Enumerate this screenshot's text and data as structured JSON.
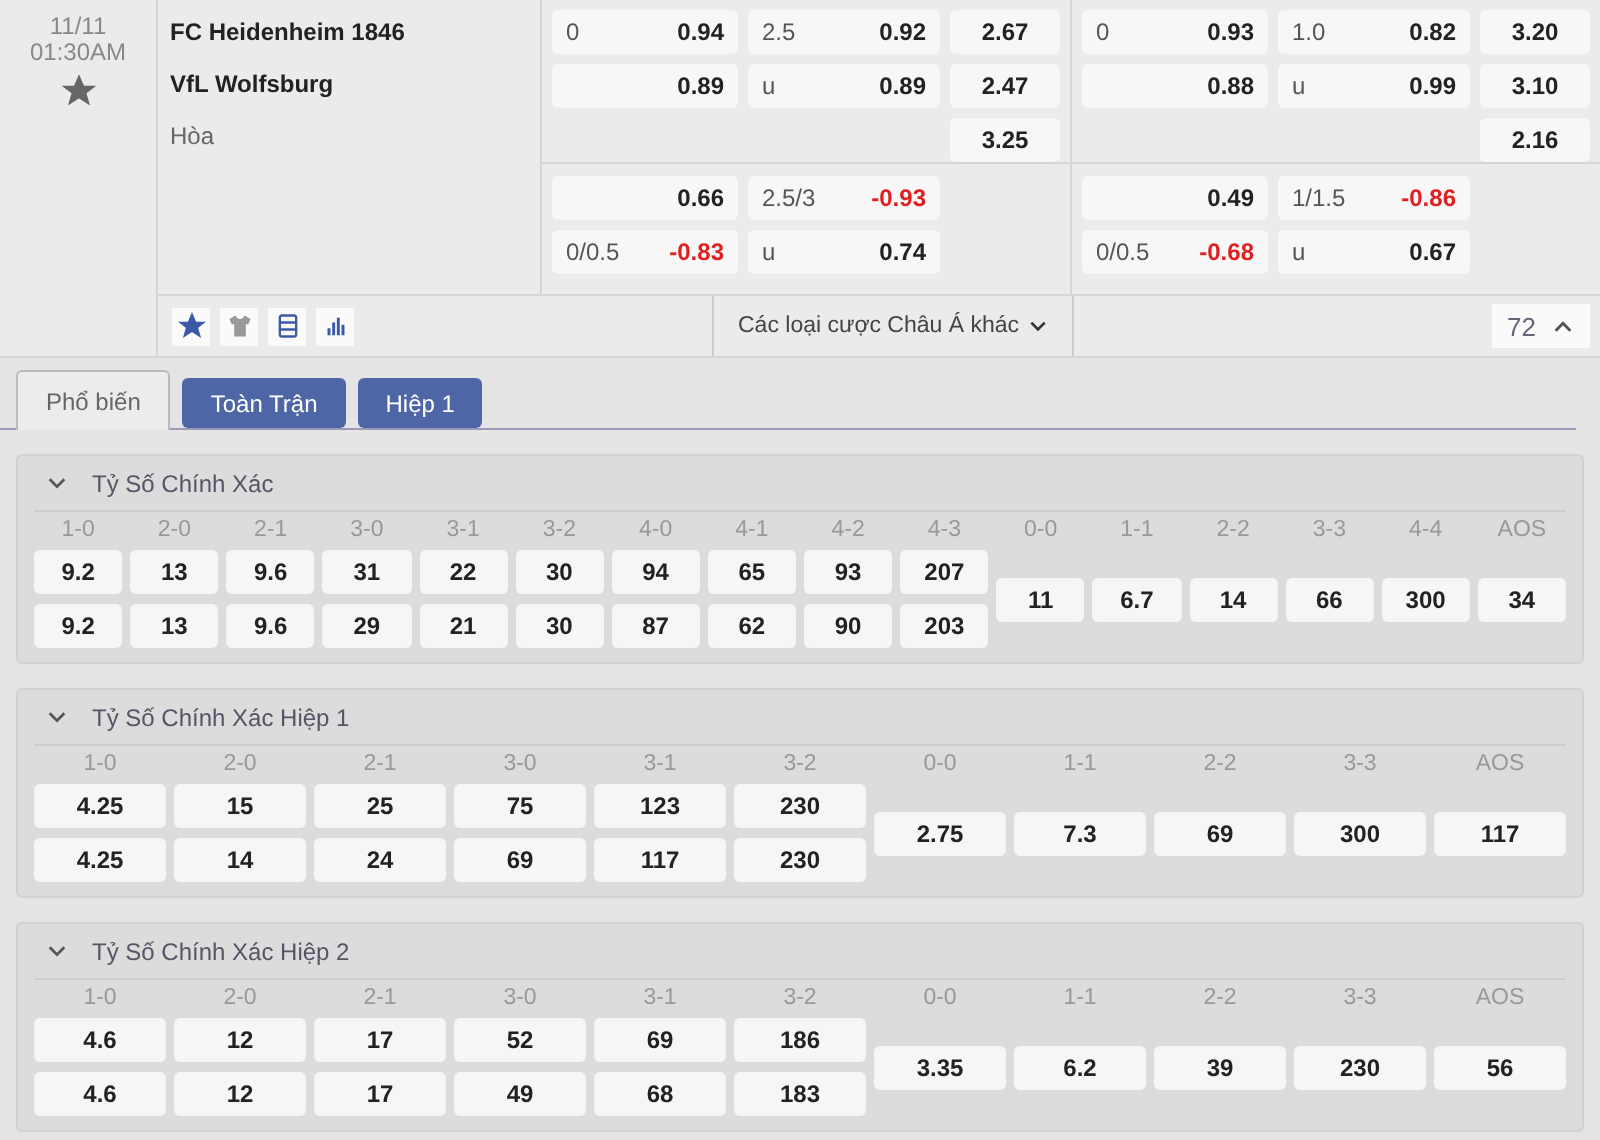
{
  "match": {
    "date": "11/11",
    "time": "01:30AM",
    "starred": true,
    "home": "FC Heidenheim 1846",
    "away": "VfL Wolfsburg",
    "draw": "Hòa"
  },
  "odds_groups": [
    {
      "main": [
        {
          "handicap": {
            "line": "0",
            "odds": "0.94",
            "negative": false
          },
          "total": {
            "line": "2.5",
            "odds": "0.92",
            "negative": false
          },
          "x12": "2.67"
        },
        {
          "handicap": {
            "odds": "0.89",
            "negative": false
          },
          "total": {
            "line": "u",
            "odds": "0.89",
            "negative": false
          },
          "x12": "2.47"
        },
        {
          "x12": "3.25"
        }
      ],
      "alt": [
        {
          "handicap": {
            "odds": "0.66",
            "negative": false
          },
          "total": {
            "line": "2.5/3",
            "odds": "-0.93",
            "negative": true
          }
        },
        {
          "handicap": {
            "line": "0/0.5",
            "odds": "-0.83",
            "negative": true
          },
          "total": {
            "line": "u",
            "odds": "0.74",
            "negative": false
          }
        }
      ]
    },
    {
      "main": [
        {
          "handicap": {
            "line": "0",
            "odds": "0.93",
            "negative": false
          },
          "total": {
            "line": "1.0",
            "odds": "0.82",
            "negative": false
          },
          "x12": "3.20"
        },
        {
          "handicap": {
            "odds": "0.88",
            "negative": false
          },
          "total": {
            "line": "u",
            "odds": "0.99",
            "negative": false
          },
          "x12": "3.10"
        },
        {
          "x12": "2.16"
        }
      ],
      "alt": [
        {
          "handicap": {
            "odds": "0.49",
            "negative": false
          },
          "total": {
            "line": "1/1.5",
            "odds": "-0.86",
            "negative": true
          }
        },
        {
          "handicap": {
            "line": "0/0.5",
            "odds": "-0.68",
            "negative": true
          },
          "total": {
            "line": "u",
            "odds": "0.67",
            "negative": false
          }
        }
      ]
    }
  ],
  "toolbar": {
    "favorite": true,
    "more_label": "Các loại cược Châu Á khác",
    "count": "72"
  },
  "tabs": [
    {
      "label": "Phổ biến",
      "selected": true
    },
    {
      "label": "Toàn Trận",
      "selected": false
    },
    {
      "label": "Hiệp 1",
      "selected": false
    }
  ],
  "sections": [
    {
      "title": "Tỷ Số Chính Xác",
      "expanded": true,
      "columns": [
        {
          "label": "1-0",
          "values": [
            "9.2",
            "9.2"
          ]
        },
        {
          "label": "2-0",
          "values": [
            "13",
            "13"
          ]
        },
        {
          "label": "2-1",
          "values": [
            "9.6",
            "9.6"
          ]
        },
        {
          "label": "3-0",
          "values": [
            "31",
            "29"
          ]
        },
        {
          "label": "3-1",
          "values": [
            "22",
            "21"
          ]
        },
        {
          "label": "3-2",
          "values": [
            "30",
            "30"
          ]
        },
        {
          "label": "4-0",
          "values": [
            "94",
            "87"
          ]
        },
        {
          "label": "4-1",
          "values": [
            "65",
            "62"
          ]
        },
        {
          "label": "4-2",
          "values": [
            "93",
            "90"
          ]
        },
        {
          "label": "4-3",
          "values": [
            "207",
            "203"
          ]
        },
        {
          "label": "0-0",
          "values": [
            "11"
          ]
        },
        {
          "label": "1-1",
          "values": [
            "6.7"
          ]
        },
        {
          "label": "2-2",
          "values": [
            "14"
          ]
        },
        {
          "label": "3-3",
          "values": [
            "66"
          ]
        },
        {
          "label": "4-4",
          "values": [
            "300"
          ]
        },
        {
          "label": "AOS",
          "values": [
            "34"
          ]
        }
      ]
    },
    {
      "title": "Tỷ Số Chính Xác Hiệp 1",
      "expanded": true,
      "columns": [
        {
          "label": "1-0",
          "values": [
            "4.25",
            "4.25"
          ]
        },
        {
          "label": "2-0",
          "values": [
            "15",
            "14"
          ]
        },
        {
          "label": "2-1",
          "values": [
            "25",
            "24"
          ]
        },
        {
          "label": "3-0",
          "values": [
            "75",
            "69"
          ]
        },
        {
          "label": "3-1",
          "values": [
            "123",
            "117"
          ]
        },
        {
          "label": "3-2",
          "values": [
            "230",
            "230"
          ]
        },
        {
          "label": "0-0",
          "values": [
            "2.75"
          ]
        },
        {
          "label": "1-1",
          "values": [
            "7.3"
          ]
        },
        {
          "label": "2-2",
          "values": [
            "69"
          ]
        },
        {
          "label": "3-3",
          "values": [
            "300"
          ]
        },
        {
          "label": "AOS",
          "values": [
            "117"
          ]
        }
      ]
    },
    {
      "title": "Tỷ Số Chính Xác Hiệp 2",
      "expanded": true,
      "columns": [
        {
          "label": "1-0",
          "values": [
            "4.6",
            "4.6"
          ]
        },
        {
          "label": "2-0",
          "values": [
            "12",
            "12"
          ]
        },
        {
          "label": "2-1",
          "values": [
            "17",
            "17"
          ]
        },
        {
          "label": "3-0",
          "values": [
            "52",
            "49"
          ]
        },
        {
          "label": "3-1",
          "values": [
            "69",
            "68"
          ]
        },
        {
          "label": "3-2",
          "values": [
            "186",
            "183"
          ]
        },
        {
          "label": "0-0",
          "values": [
            "3.35"
          ]
        },
        {
          "label": "1-1",
          "values": [
            "6.2"
          ]
        },
        {
          "label": "2-2",
          "values": [
            "39"
          ]
        },
        {
          "label": "3-3",
          "values": [
            "230"
          ]
        },
        {
          "label": "AOS",
          "values": [
            "56"
          ]
        }
      ]
    }
  ]
}
